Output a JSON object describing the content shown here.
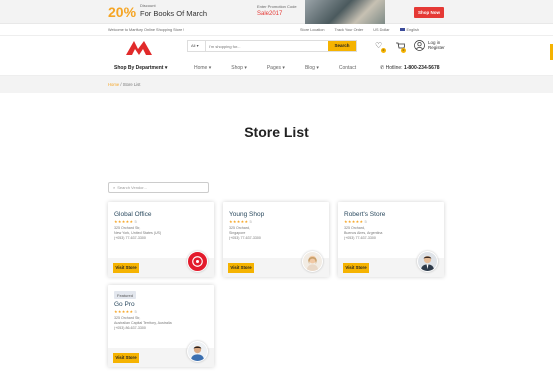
{
  "promo": {
    "percent": "20%",
    "discount_label": "Discount",
    "title": "For Books Of March",
    "code_label": "Enter Promotion Code",
    "code": "Sale2017",
    "shop_button": "Shop Now"
  },
  "topbar": {
    "welcome": "Welcome to Martfury Online Shopping Store !",
    "links": [
      "Store Location",
      "Track Your Order",
      "US Dollar",
      "English"
    ]
  },
  "header": {
    "category": "All",
    "search_placeholder": "I'm shopping for...",
    "search_button": "Search",
    "wishlist_count": "0",
    "cart_count": "0",
    "login": "Log in",
    "register": "Register"
  },
  "nav": {
    "department": "Shop By Department",
    "menu": [
      "Home",
      "Shop",
      "Pages",
      "Blog",
      "Contact"
    ],
    "hotline_label": "Hotline:",
    "hotline": "1-800-234-5678"
  },
  "breadcrumb": {
    "home": "Home",
    "sep": "/",
    "current": "Store List"
  },
  "page_title": "Store List",
  "vendor_search": {
    "placeholder": "Search Vendor..."
  },
  "stores": [
    {
      "badge": "",
      "name": "Global Office",
      "stars": "★★★★★",
      "rating": "5",
      "addr1": "325 Orchard Str,",
      "addr2": "New York, United States (US)",
      "phone": "(+053) 77-637-3300",
      "visit": "Visit Store"
    },
    {
      "badge": "",
      "name": "Young Shop",
      "stars": "★★★★★",
      "rating": "5",
      "addr1": "325 Orchard,",
      "addr2": "Singapore",
      "phone": "(+053) 77-637-3300",
      "visit": "Visit Store"
    },
    {
      "badge": "",
      "name": "Robert's Store",
      "stars": "★★★★★",
      "rating": "5",
      "addr1": "325 Orchard,",
      "addr2": "Buenos Aires, Argentina",
      "phone": "(+053) 77-637-3300",
      "visit": "Visit Store"
    },
    {
      "badge": "Featured",
      "name": "Go Pro",
      "stars": "★★★★★",
      "rating": "5",
      "addr1": "325 Orchard Str,",
      "addr2": "Australian Capital Territory, Australia",
      "phone": "(+053) 86-637-3300",
      "visit": "Visit Store"
    }
  ]
}
